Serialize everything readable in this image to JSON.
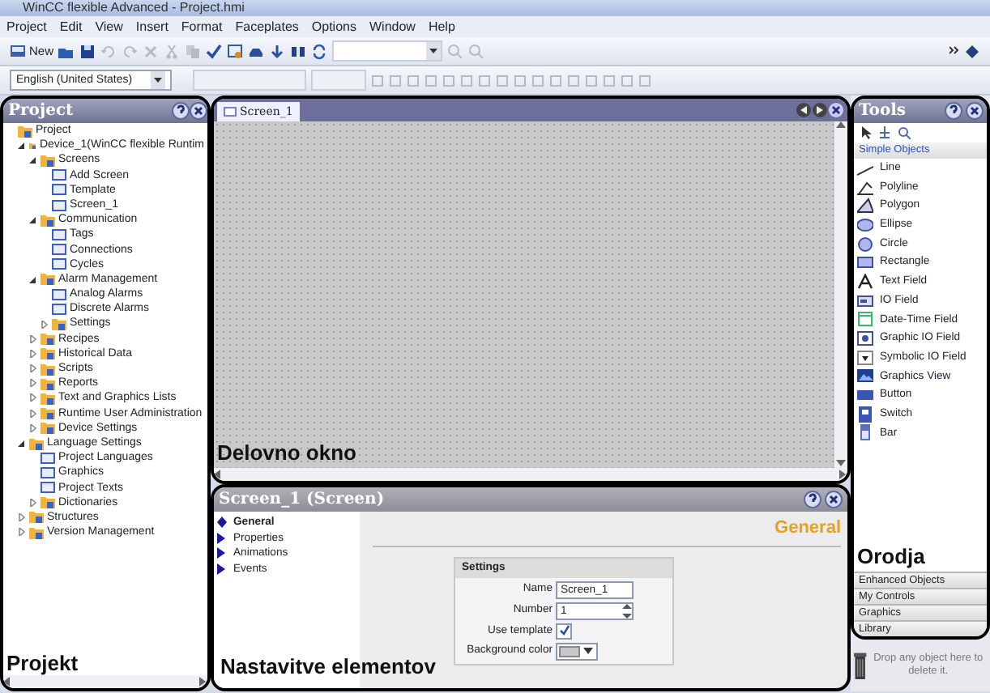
{
  "window": {
    "title": "WinCC flexible Advanced - Project.hmi"
  },
  "menu": [
    "Project",
    "Edit",
    "View",
    "Insert",
    "Format",
    "Faceplates",
    "Options",
    "Window",
    "Help"
  ],
  "toolbar": {
    "new_label": "New",
    "language": "English (United States)"
  },
  "project_panel": {
    "title": "Project",
    "annotation": "Projekt",
    "tree": [
      {
        "label": "Project",
        "children": [
          {
            "label": "Device_1(WinCC flexible Runtim",
            "expanded": true,
            "children": [
              {
                "label": "Screens",
                "expanded": true,
                "children": [
                  {
                    "label": "Add Screen"
                  },
                  {
                    "label": "Template"
                  },
                  {
                    "label": "Screen_1"
                  }
                ]
              },
              {
                "label": "Communication",
                "expanded": true,
                "children": [
                  {
                    "label": "Tags"
                  },
                  {
                    "label": "Connections"
                  },
                  {
                    "label": "Cycles"
                  }
                ]
              },
              {
                "label": "Alarm Management",
                "expanded": true,
                "children": [
                  {
                    "label": "Analog Alarms"
                  },
                  {
                    "label": "Discrete Alarms"
                  },
                  {
                    "label": "Settings",
                    "expanded": false
                  }
                ]
              },
              {
                "label": "Recipes",
                "expanded": false
              },
              {
                "label": "Historical Data",
                "expanded": false
              },
              {
                "label": "Scripts",
                "expanded": false
              },
              {
                "label": "Reports",
                "expanded": false
              },
              {
                "label": "Text and Graphics Lists",
                "expanded": false
              },
              {
                "label": "Runtime User Administration",
                "expanded": false
              },
              {
                "label": "Device Settings",
                "expanded": false
              }
            ]
          },
          {
            "label": "Language Settings",
            "expanded": true,
            "children": [
              {
                "label": "Project Languages"
              },
              {
                "label": "Graphics"
              },
              {
                "label": "Project Texts"
              },
              {
                "label": "Dictionaries",
                "expanded": false
              }
            ]
          },
          {
            "label": "Structures",
            "expanded": false
          },
          {
            "label": "Version Management",
            "expanded": false
          }
        ]
      }
    ]
  },
  "editor": {
    "tabs": [
      {
        "label": "Screen_1",
        "selected": true
      }
    ],
    "annotation": "Delovno okno"
  },
  "properties": {
    "title": "Screen_1 (Screen)",
    "annotation": "Nastavitve elementov",
    "nav": [
      {
        "label": "General",
        "selected": true
      },
      {
        "label": "Properties",
        "selected": false
      },
      {
        "label": "Animations",
        "selected": false
      },
      {
        "label": "Events",
        "selected": false
      }
    ],
    "heading": "General",
    "group": "Settings",
    "fields": [
      {
        "kind": "text",
        "label": "Name",
        "value": "Screen_1"
      },
      {
        "kind": "spin",
        "label": "Number",
        "value": "1"
      },
      {
        "kind": "checkbox",
        "label": "Use template",
        "checked": true
      },
      {
        "kind": "color",
        "label": "Background color"
      }
    ]
  },
  "tools": {
    "title": "Tools",
    "section": "Simple Objects",
    "annotation": "Orodja",
    "items": [
      "Line",
      "Polyline",
      "Polygon",
      "Ellipse",
      "Circle",
      "Rectangle",
      "Text Field",
      "IO Field",
      "Date-Time Field",
      "Graphic IO Field",
      "Symbolic IO Field",
      "Graphics View",
      "Button",
      "Switch",
      "Bar"
    ],
    "sections": [
      "Enhanced Objects",
      "My Controls",
      "Graphics",
      "Library"
    ],
    "trash_hint": "Drop any object here to delete it."
  }
}
